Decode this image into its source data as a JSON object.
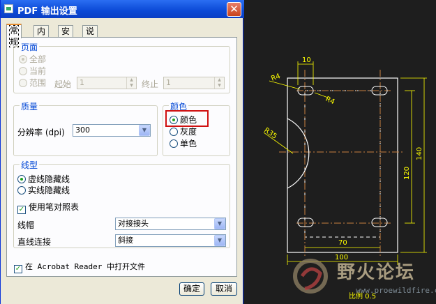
{
  "dialog": {
    "title": "PDF 输出设置",
    "close_label": "✕",
    "tabs": [
      "常规",
      "内容",
      "安全",
      "说明"
    ],
    "page_group": {
      "title": "页面",
      "options": [
        "全部",
        "当前",
        "范围"
      ],
      "start_label": "起始",
      "start_value": "1",
      "end_label": "终止",
      "end_value": "1"
    },
    "quality_group": {
      "title": "质量",
      "resolution_label": "分辨率 (dpi)",
      "resolution_value": "300"
    },
    "color_group": {
      "title": "颜色",
      "options": [
        "颜色",
        "灰度",
        "单色"
      ]
    },
    "linetype_group": {
      "title": "线型",
      "options": [
        "虚线隐藏线",
        "实线隐藏线"
      ],
      "pen_table_label": "使用笔对照表",
      "cap_label": "线帽",
      "cap_value": "对接接头",
      "join_label": "直线连接",
      "join_value": "斜接"
    },
    "open_in_acrobat_label": "在 Acrobat Reader 中打开文件",
    "ok_label": "确定",
    "cancel_label": "取消"
  },
  "drawing": {
    "dim_top": "10",
    "dim_r4_a": "R4",
    "dim_r4_b": "R4",
    "dim_r35": "R35",
    "dim_120": "120",
    "dim_140": "140",
    "dim_70": "70",
    "dim_100": "100",
    "scale_label": "比例 0.5"
  },
  "watermark": {
    "text": "野火论坛",
    "url": "www.proewildfire.cn"
  },
  "colors": {
    "title_bar": "#0b49d6",
    "dialog_bg": "#ece9d8",
    "cad_bg": "#1e1e1e",
    "cad_line": "#ffffff",
    "cad_dim": "#ffff00",
    "cad_center": "#c88040",
    "highlight": "#d01010"
  }
}
